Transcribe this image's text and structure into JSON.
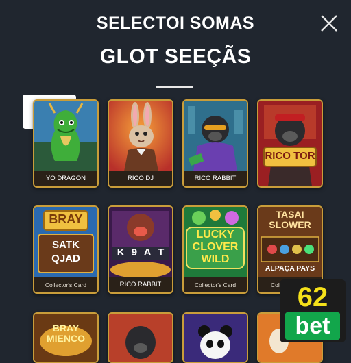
{
  "header": {
    "title_line1": "SELECTOI SOMAS",
    "title_line2": "GLOT SEEÇÃS"
  },
  "games": [
    {
      "caption": "YO DRAGON"
    },
    {
      "caption": "RICO DJ"
    },
    {
      "caption": "RICO RABBIT"
    },
    {
      "caption": "",
      "art_text": "RICO TOR"
    },
    {
      "caption": "Collector's Card",
      "art_text": "BRAY",
      "reels": "SATK QJAD"
    },
    {
      "caption": "RICO RABBIT",
      "reels": "K 9 A T"
    },
    {
      "caption": "Collector's Card",
      "art_text": "LUCKY CLOVER WILD"
    },
    {
      "caption": "ALPAÇA PAYS",
      "caption2": "Colle",
      "art_text": "TASAI SLOWER"
    },
    {
      "caption": "",
      "art_text": "BRAY MIENCO"
    },
    {
      "caption": ""
    },
    {
      "caption": ""
    },
    {
      "caption": ""
    }
  ],
  "brand": {
    "num": "62",
    "word": "bet",
    "num_color": "#f5e11a",
    "word_bg": "#12a64b"
  },
  "colors": {
    "background": "#20262f",
    "card_border": "#c99d3a"
  },
  "icons": {
    "close": "close-icon"
  }
}
